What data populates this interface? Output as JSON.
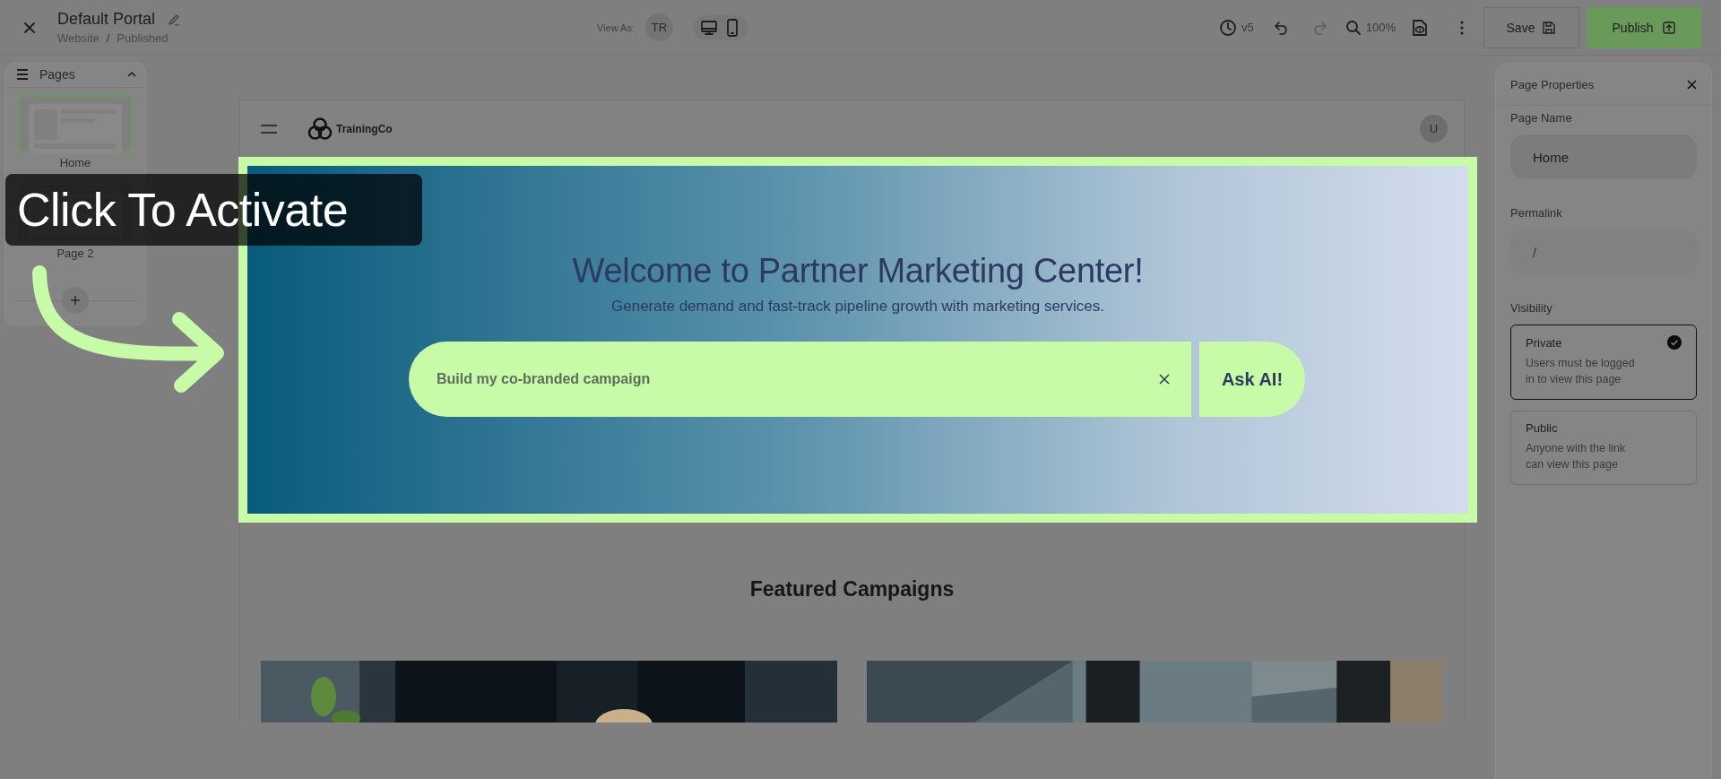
{
  "toolbar": {
    "title": "Default Portal",
    "breadcrumb": [
      "Website",
      "Published"
    ],
    "separator": "/",
    "view_as_label": "View As:",
    "view_as_user": "TR",
    "version": "v5",
    "undo": {
      "disabled": false
    },
    "redo": {
      "disabled": true
    },
    "zoom": "100%",
    "save": "Save",
    "publish": "Publish"
  },
  "pages_panel": {
    "title": "Pages",
    "expanded": true,
    "pages": [
      {
        "label": "Home",
        "selected": true
      },
      {
        "label": "Page 2",
        "selected": false
      }
    ]
  },
  "tooltip": "Click To Activate",
  "preview": {
    "brand": "TrainingCo",
    "avatar": "U",
    "hero": {
      "title": "Welcome to Partner Marketing Center!",
      "subtitle": "Generate demand and fast-track pipeline growth with marketing services.",
      "placeholder": "Build my co-branded campaign",
      "button": "Ask AI!"
    },
    "section_title": "Featured Campaigns"
  },
  "properties": {
    "title": "Page Properties",
    "page_name_label": "Page Name",
    "page_name": "Home",
    "permalink_label": "Permalink",
    "permalink": "/",
    "visibility_label": "Visibility",
    "options": [
      {
        "label": "Private",
        "description": "Users must be logged in to view this page",
        "selected": true
      },
      {
        "label": "Public",
        "description": "Anyone with the link can view this page",
        "selected": false
      }
    ]
  }
}
